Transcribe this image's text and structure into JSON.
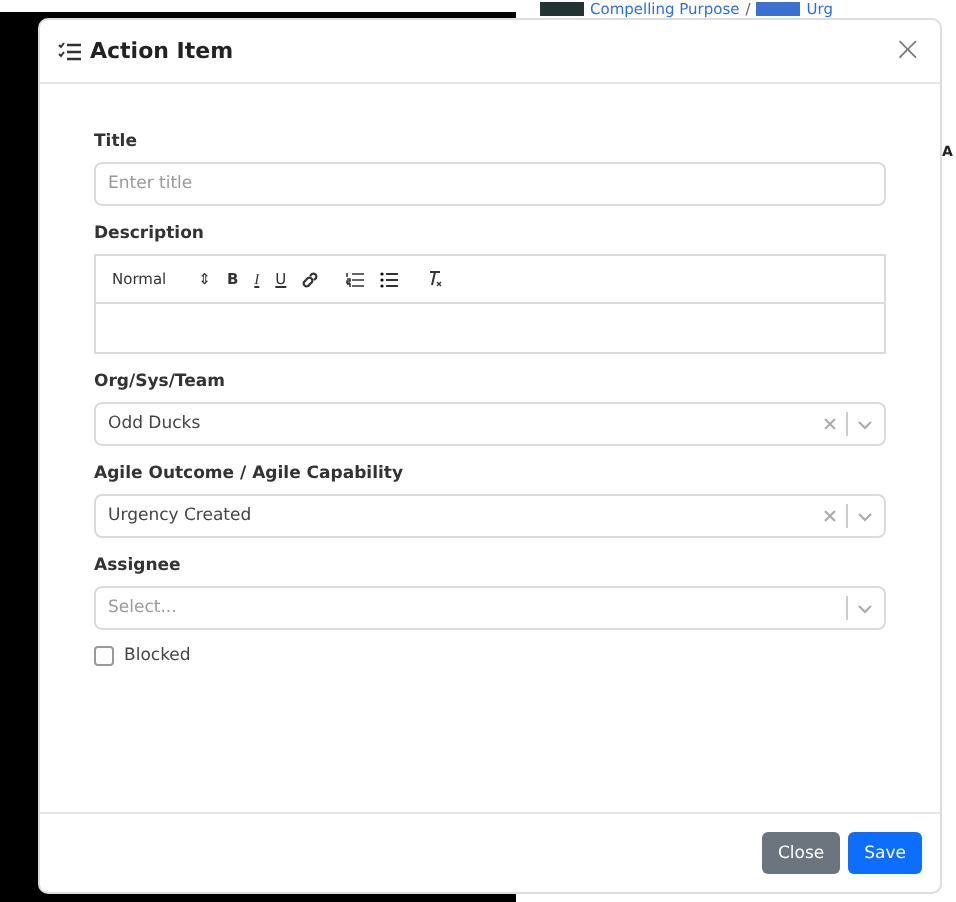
{
  "background": {
    "breadcrumb": [
      "Compelling Purpose",
      "/",
      "Urg"
    ],
    "side_letter": "A"
  },
  "modal": {
    "title": "Action Item",
    "close_icon": "×",
    "fields": [
      {
        "kind": "text",
        "label": "Title",
        "placeholder": "Enter title"
      },
      {
        "kind": "editor",
        "label": "Description",
        "toolbar": {
          "format": "Normal",
          "format_arrow": "⇕",
          "buttons": [
            "B",
            "I",
            "U"
          ]
        }
      },
      {
        "kind": "select",
        "label": "Org/Sys/Team",
        "value": "Odd Ducks",
        "clearable": true
      },
      {
        "kind": "select",
        "label": "Agile Outcome / Agile Capability",
        "value": "Urgency Created",
        "clearable": true
      },
      {
        "kind": "select",
        "label": "Assignee",
        "placeholder": "Select...",
        "clearable": false
      },
      {
        "kind": "checkbox",
        "label": "Blocked",
        "checked": false
      }
    ],
    "buttons": [
      {
        "label": "Close",
        "kind": "secondary"
      },
      {
        "label": "Save",
        "kind": "primary"
      }
    ]
  }
}
